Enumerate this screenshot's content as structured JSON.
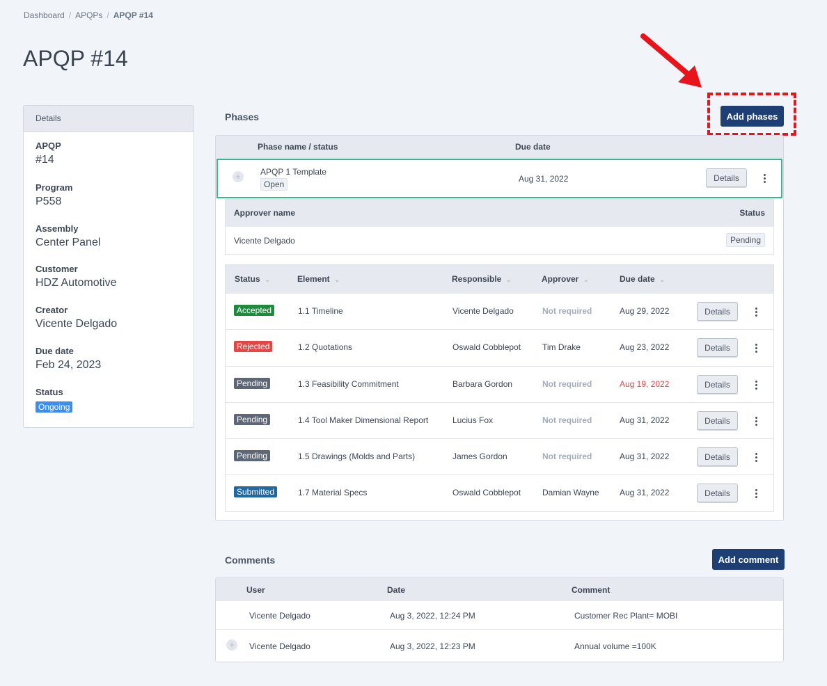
{
  "breadcrumb": {
    "items": [
      "Dashboard",
      "APQPs"
    ],
    "current": "APQP #14",
    "separator": "/"
  },
  "page_title": "APQP #14",
  "details": {
    "header": "Details",
    "fields": [
      {
        "label": "APQP",
        "value": "#14"
      },
      {
        "label": "Program",
        "value": "P558"
      },
      {
        "label": "Assembly",
        "value": "Center Panel"
      },
      {
        "label": "Customer",
        "value": "HDZ Automotive"
      },
      {
        "label": "Creator",
        "value": "Vicente Delgado"
      },
      {
        "label": "Due date",
        "value": "Feb 24, 2023"
      },
      {
        "label": "Status",
        "value": "Ongoing"
      }
    ]
  },
  "phases": {
    "title": "Phases",
    "add_button": "Add phases",
    "columns": {
      "name": "Phase name / status",
      "due": "Due date"
    },
    "row": {
      "name": "APQP 1 Template",
      "status": "Open",
      "due": "Aug 31, 2022",
      "details_label": "Details"
    },
    "approvers": {
      "columns": {
        "name": "Approver name",
        "status": "Status"
      },
      "rows": [
        {
          "name": "Vicente Delgado",
          "status": "Pending"
        }
      ]
    },
    "elements": {
      "columns": {
        "status": "Status",
        "element": "Element",
        "responsible": "Responsible",
        "approver": "Approver",
        "due": "Due date"
      },
      "rows": [
        {
          "status": "Accepted",
          "element": "1.1 Timeline",
          "responsible": "Vicente Delgado",
          "approver": "Not required",
          "due": "Aug 29, 2022",
          "details": "Details"
        },
        {
          "status": "Rejected",
          "element": "1.2 Quotations",
          "responsible": "Oswald Cobblepot",
          "approver": "Tim Drake",
          "due": "Aug 23, 2022",
          "details": "Details"
        },
        {
          "status": "Pending",
          "element": "1.3 Feasibility Commitment",
          "responsible": "Barbara Gordon",
          "approver": "Not required",
          "due": "Aug 19, 2022",
          "details": "Details"
        },
        {
          "status": "Pending",
          "element": "1.4 Tool Maker Dimensional Report",
          "responsible": "Lucius Fox",
          "approver": "Not required",
          "due": "Aug 31, 2022",
          "details": "Details"
        },
        {
          "status": "Pending",
          "element": "1.5 Drawings (Molds and Parts)",
          "responsible": "James Gordon",
          "approver": "Not required",
          "due": "Aug 31, 2022",
          "details": "Details"
        },
        {
          "status": "Submitted",
          "element": "1.7 Material Specs",
          "responsible": "Oswald Cobblepot",
          "approver": "Damian Wayne",
          "due": "Aug 31, 2022",
          "details": "Details"
        }
      ]
    }
  },
  "comments": {
    "title": "Comments",
    "add_button": "Add comment",
    "columns": {
      "user": "User",
      "date": "Date",
      "comment": "Comment"
    },
    "rows": [
      {
        "user": "Vicente Delgado",
        "date": "Aug 3, 2022, 12:24 PM",
        "comment": "Customer Rec Plant= MOBI"
      },
      {
        "user": "Vicente Delgado",
        "date": "Aug 3, 2022, 12:23 PM",
        "comment": "Annual volume =100K"
      }
    ]
  },
  "colors": {
    "primary": "#1e3f73",
    "accepted": "#1f8a3e",
    "rejected": "#e04848",
    "pending": "#5d6776",
    "submitted": "#1f69a0",
    "ongoing": "#3a8ef0",
    "annotation": "#e8141b",
    "row_highlight": "#3db58a"
  },
  "icons": [
    "plus-circle-icon",
    "kebab-menu-icon",
    "chevron-down-icon",
    "red-arrow-annotation"
  ]
}
